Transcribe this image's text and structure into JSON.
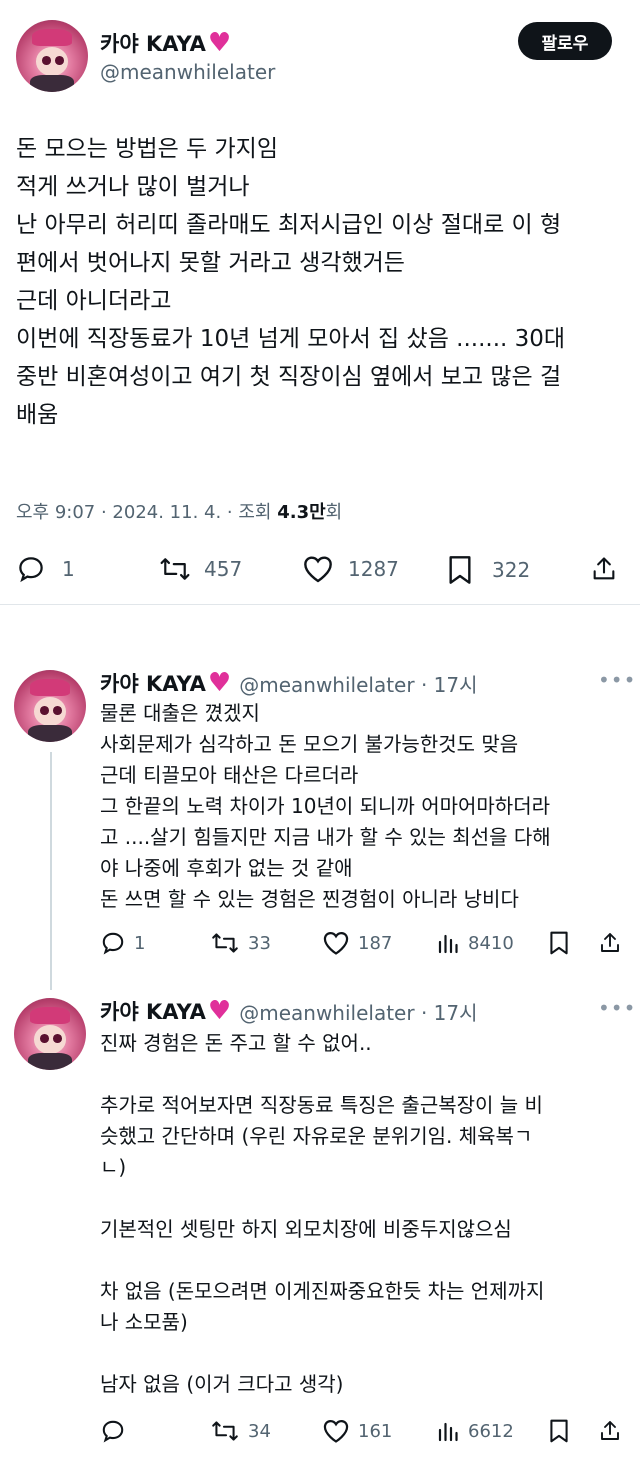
{
  "main_tweet": {
    "display_name": "카야 KAYA",
    "handle": "@meanwhilelater",
    "follow_label": "팔로우",
    "body_lines": [
      "돈 모으는 방법은 두 가지임",
      "적게 쓰거나 많이 벌거나",
      "난 아무리 허리띠 졸라매도 최저시급인 이상 절대로 이 형",
      "편에서 벗어나지 못할 거라고 생각했거든",
      "근데 아니더라고",
      "이번에 직장동료가 10년 넘게 모아서 집 샀음 ....... 30대",
      "중반 비혼여성이고 여기 첫 직장이심 옆에서 보고 많은 걸",
      "배움"
    ],
    "time": "오후 9:07 · 2024. 11. 4. · 조회 ",
    "views": "4.3만",
    "views_suffix": "회",
    "stats": {
      "replies": "1",
      "retweets": "457",
      "likes": "1287",
      "bookmarks": "322"
    }
  },
  "replies": [
    {
      "display_name": "카야 KAYA",
      "handle": "@meanwhilelater · 17시",
      "body_lines": [
        "물론 대출은 꼈겠지",
        "사회문제가 심각하고 돈 모으기 불가능한것도 맞음",
        "근데 티끌모아 태산은 다르더라",
        "그 한끝의 노력 차이가 10년이 되니까 어마어마하더라",
        "고 ....살기 힘들지만 지금 내가 할 수 있는 최선을 다해",
        "야 나중에 후회가 없는 것 같애",
        "돈 쓰면 할 수 있는 경험은 찐경험이 아니라 낭비다"
      ],
      "stats": {
        "replies": "1",
        "retweets": "33",
        "likes": "187",
        "views": "8410"
      }
    },
    {
      "display_name": "카야 KAYA",
      "handle": "@meanwhilelater · 17시",
      "body_lines": [
        "진짜 경험은 돈 주고 할 수 없어..",
        "",
        "추가로 적어보자면 직장동료 특징은 출근복장이 늘 비",
        "슷했고 간단하며 (우린 자유로운 분위기임. 체육복ㄱ",
        "ㄴ)",
        "",
        "기본적인 셋팅만 하지 외모치장에 비중두지않으심",
        "",
        "차 없음 (돈모으려면 이게진짜중요한듯 차는 언제까지",
        "나 소모품)",
        "",
        "남자 없음 (이거 크다고 생각)"
      ],
      "stats": {
        "replies": "",
        "retweets": "34",
        "likes": "161",
        "views": "6612"
      }
    }
  ],
  "icons": {
    "reply": "reply-icon",
    "retweet": "retweet-icon",
    "like": "heart-icon",
    "bookmark": "bookmark-icon",
    "share": "share-icon",
    "views": "views-icon",
    "more": "more-icon"
  },
  "colors": {
    "text": "#0f1419",
    "muted": "#536471",
    "heart": "#e0309a",
    "button": "#0f1419"
  }
}
